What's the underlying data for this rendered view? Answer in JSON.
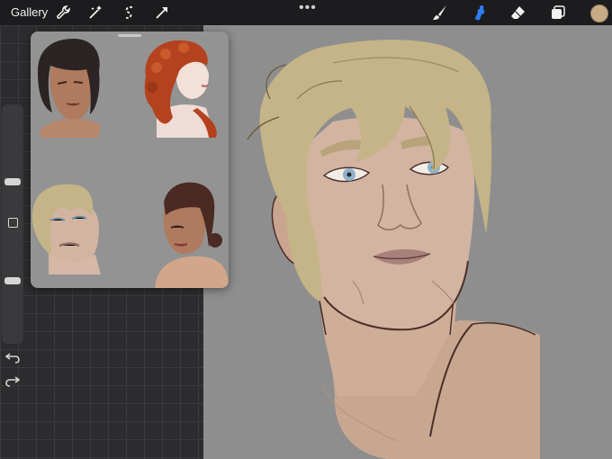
{
  "topbar": {
    "gallery_label": "Gallery",
    "tools_left": [
      "wrench-icon",
      "magic-wand-icon",
      "selection-icon",
      "transform-arrow-icon"
    ],
    "more_label": "•••",
    "tools_right": [
      "brush-icon",
      "smudge-icon",
      "eraser-icon",
      "layers-icon"
    ],
    "active_tool": "smudge-icon",
    "current_color": "#c6ab84",
    "accent_color": "#2f7df6"
  },
  "sidebar": {
    "brush_size_level": 0.33,
    "opacity_level": 0.3
  },
  "reference_panel": {
    "thumbnails": [
      "portrait-dark-hair",
      "portrait-red-curly-hair",
      "portrait-blond-man",
      "portrait-woman-bun"
    ]
  }
}
